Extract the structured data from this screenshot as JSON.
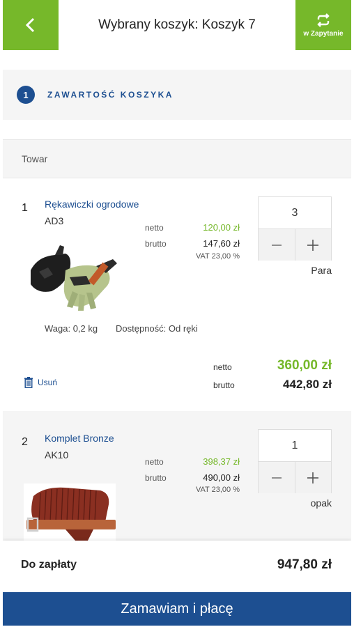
{
  "header": {
    "title": "Wybrany koszyk: Koszyk 7",
    "inquiry_label": "w Zapytanie",
    "back_icon": "chevron-left-icon",
    "inquiry_icon": "repeat-icon"
  },
  "step": {
    "number": "1",
    "label": "ZAWARTOŚĆ KOSZYKA"
  },
  "table": {
    "column_header": "Towar"
  },
  "items": [
    {
      "index": "1",
      "name": "Rękawiczki ogrodowe",
      "code": "AD3",
      "net_label": "netto",
      "net_price": "120,00 zł",
      "gross_label": "brutto",
      "gross_price": "147,60 zł",
      "vat": "VAT 23,00 %",
      "quantity": "3",
      "unit": "Para",
      "weight": "Waga: 0,2 kg",
      "availability": "Dostępność: Od ręki",
      "remove_label": "Usuń",
      "total_net_label": "netto",
      "total_net": "360,00 zł",
      "total_gross_label": "brutto",
      "total_gross": "442,80 zł"
    },
    {
      "index": "2",
      "name": "Komplet Bronze",
      "code": "AK10",
      "net_label": "netto",
      "net_price": "398,37 zł",
      "gross_label": "brutto",
      "gross_price": "490,00 zł",
      "vat": "VAT 23,00 %",
      "quantity": "1",
      "unit": "opak"
    }
  ],
  "summary": {
    "label": "Do zapłaty",
    "value": "947,80 zł"
  },
  "order_button": "Zamawiam i płacę",
  "colors": {
    "accent_green": "#76b82a",
    "brand_blue": "#1d4f91"
  }
}
